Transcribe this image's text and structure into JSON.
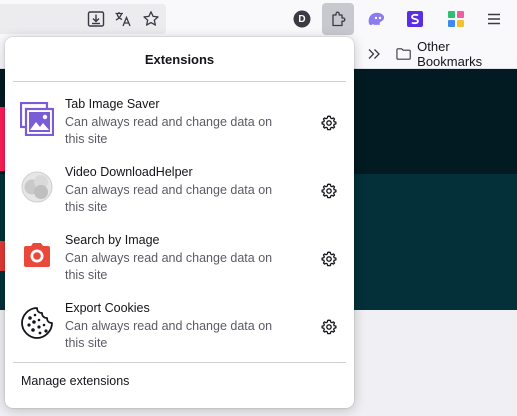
{
  "toolbar": {
    "icons": [
      "save-page-icon",
      "translate-icon",
      "bookmark-star-icon",
      "account-avatar-icon",
      "extensions-puzzle-icon",
      "ghost-extension-icon",
      "purple-s-extension-icon",
      "colorful-grid-extension-icon",
      "hamburger-menu-icon"
    ],
    "avatar_letter": "D"
  },
  "bookmarks": {
    "folder_label": "Other Bookmarks"
  },
  "panel": {
    "title": "Extensions",
    "extensions": [
      {
        "name": "Tab Image Saver",
        "description": "Can always read and change data on this site",
        "icon": "tab-image-saver-icon"
      },
      {
        "name": "Video DownloadHelper",
        "description": "Can always read and change data on this site",
        "icon": "video-downloadhelper-icon"
      },
      {
        "name": "Search by Image",
        "description": "Can always read and change data on this site",
        "icon": "search-by-image-camera-icon"
      },
      {
        "name": "Export Cookies",
        "description": "Can always read and change data on this site",
        "icon": "export-cookies-icon"
      }
    ],
    "manage_label": "Manage extensions"
  },
  "colors": {
    "panel_bg": "#ffffff",
    "toolbar_bg": "#f9f9fb",
    "page_dark": "#021b22",
    "accent_purple": "#7a5cd6",
    "camera_red": "#e8493a"
  }
}
